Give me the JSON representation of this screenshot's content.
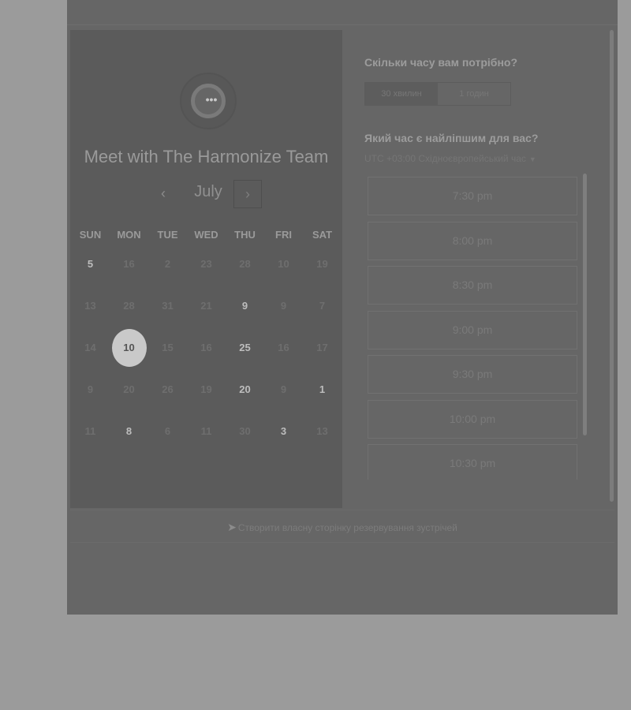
{
  "organizer": {
    "name": "Meet with The Harmonize Team",
    "avatar_icon": "chat-bubble-icon"
  },
  "calendar": {
    "prev_label": "‹",
    "month": "July",
    "next_label": "›",
    "weekdays": [
      "SUN",
      "MON",
      "TUE",
      "WED",
      "THU",
      "FRI",
      "SAT"
    ],
    "weeks": [
      [
        {
          "d": "5",
          "avail": true
        },
        {
          "d": "16",
          "avail": false
        },
        {
          "d": "2",
          "avail": false
        },
        {
          "d": "23",
          "avail": false
        },
        {
          "d": "28",
          "avail": false
        },
        {
          "d": "10",
          "avail": false
        },
        {
          "d": "19",
          "avail": false
        }
      ],
      [
        {
          "d": "13",
          "avail": false
        },
        {
          "d": "28",
          "avail": false
        },
        {
          "d": "31",
          "avail": false
        },
        {
          "d": "21",
          "avail": false
        },
        {
          "d": "9",
          "avail": true
        },
        {
          "d": "9",
          "avail": false
        },
        {
          "d": "7",
          "avail": false
        }
      ],
      [
        {
          "d": "14",
          "avail": false
        },
        {
          "d": "10",
          "avail": true,
          "selected": true
        },
        {
          "d": "15",
          "avail": false
        },
        {
          "d": "16",
          "avail": false
        },
        {
          "d": "25",
          "avail": true
        },
        {
          "d": "16",
          "avail": false
        },
        {
          "d": "17",
          "avail": false
        }
      ],
      [
        {
          "d": "9",
          "avail": false
        },
        {
          "d": "20",
          "avail": false
        },
        {
          "d": "26",
          "avail": false
        },
        {
          "d": "19",
          "avail": false
        },
        {
          "d": "20",
          "avail": true
        },
        {
          "d": "9",
          "avail": false
        },
        {
          "d": "1",
          "avail": true
        }
      ],
      [
        {
          "d": "11",
          "avail": false
        },
        {
          "d": "8",
          "avail": true
        },
        {
          "d": "6",
          "avail": false
        },
        {
          "d": "11",
          "avail": false
        },
        {
          "d": "30",
          "avail": false
        },
        {
          "d": "3",
          "avail": true
        },
        {
          "d": "13",
          "avail": false
        }
      ]
    ]
  },
  "booking": {
    "duration_question": "Скільки часу вам потрібно?",
    "durations": [
      {
        "label": "30 хвилин",
        "active": true
      },
      {
        "label": "1 годин",
        "active": false
      }
    ],
    "time_question": "Який час є найліпшим для вас?",
    "timezone": "UTC +03:00 Східноєвропейський час",
    "slots": [
      "7:30 pm",
      "8:00 pm",
      "8:30 pm",
      "9:00 pm",
      "9:30 pm",
      "10:00 pm",
      "10:30 pm"
    ]
  },
  "footer": {
    "link_text": "Створити власну сторінку резервування зустрічей"
  }
}
